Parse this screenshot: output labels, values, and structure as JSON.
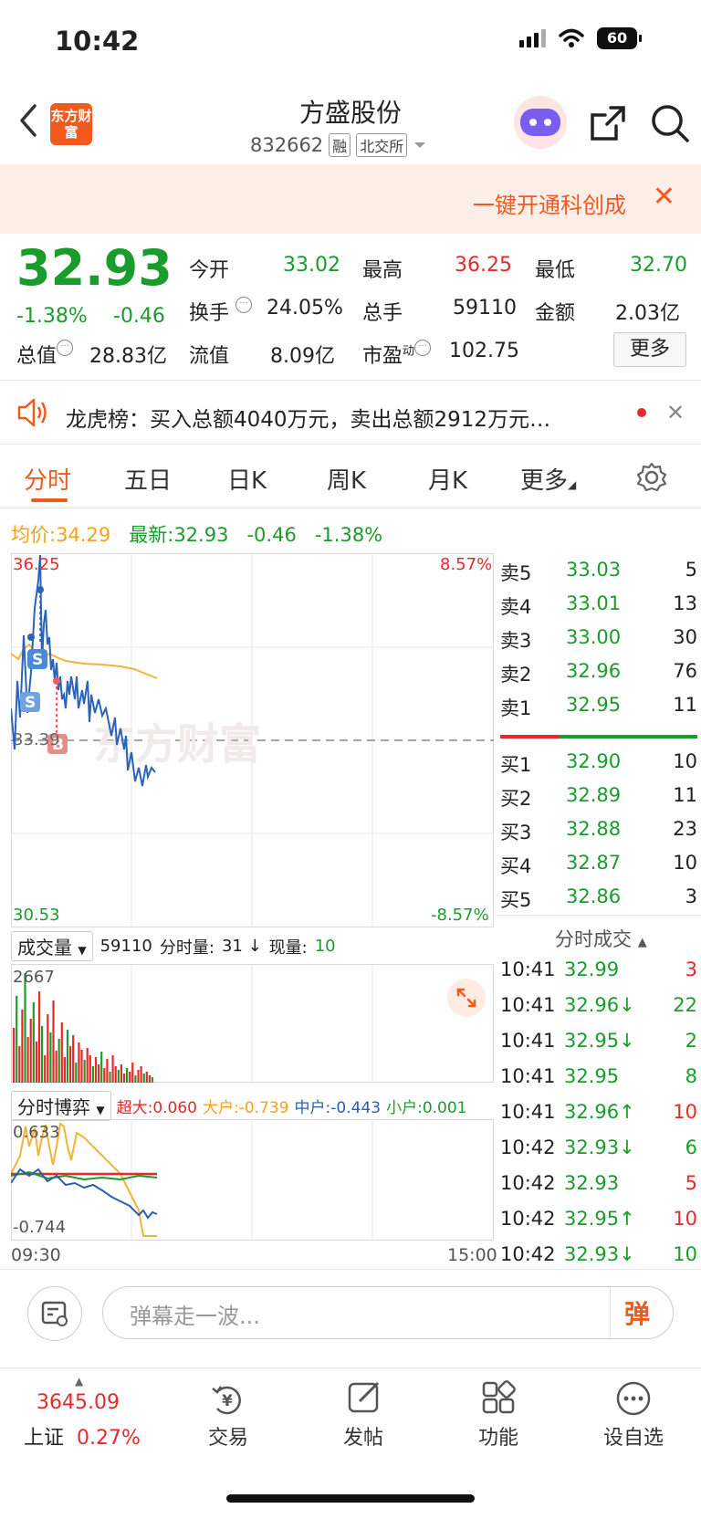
{
  "status_bar": {
    "time": "10:42",
    "battery": "60"
  },
  "header": {
    "logo_text": "东方财富",
    "title": "方盛股份",
    "code": "832662",
    "tag_margin": "融",
    "tag_exchange": "北交所"
  },
  "banner": {
    "text": "一键开通科创成"
  },
  "quote": {
    "price": "32.93",
    "change_pct": "-1.38%",
    "change": "-0.46",
    "fields": [
      {
        "label": "今开",
        "value": "33.02"
      },
      {
        "label": "最高",
        "value": "36.25"
      },
      {
        "label": "最低",
        "value": "32.70"
      },
      {
        "label": "换手",
        "value": "24.05%"
      },
      {
        "label": "总手",
        "value": "59110"
      },
      {
        "label": "金额",
        "value": "2.03亿"
      },
      {
        "label": "总值",
        "value": "28.83亿"
      },
      {
        "label": "流值",
        "value": "8.09亿"
      },
      {
        "label": "市盈",
        "value": "102.75"
      }
    ],
    "pe_sup": "动",
    "more": "更多"
  },
  "dragon_tiger": {
    "text": "龙虎榜：买入总额4040万元，卖出总额2912万元…"
  },
  "tabs": [
    "分时",
    "五日",
    "日K",
    "周K",
    "月K",
    "更多"
  ],
  "intraday": {
    "avg_label": "均价:",
    "avg_value": "34.29",
    "latest_label": "最新:",
    "latest_value": "32.93",
    "latest_change": "-0.46",
    "latest_pct": "-1.38%",
    "high_price": "36.25",
    "high_pct": "8.57%",
    "low_price": "30.53",
    "low_pct": "-8.57%",
    "prev_close": "33.39",
    "watermark": "东方财富",
    "marker_s": "S",
    "marker_b": "B",
    "time_start": "09:30",
    "time_end": "15:00"
  },
  "order_book": {
    "asks": [
      {
        "label": "卖5",
        "price": "33.03",
        "vol": "5"
      },
      {
        "label": "卖4",
        "price": "33.01",
        "vol": "13"
      },
      {
        "label": "卖3",
        "price": "33.00",
        "vol": "30"
      },
      {
        "label": "卖2",
        "price": "32.96",
        "vol": "76"
      },
      {
        "label": "卖1",
        "price": "32.95",
        "vol": "11"
      }
    ],
    "bids": [
      {
        "label": "买1",
        "price": "32.90",
        "vol": "10"
      },
      {
        "label": "买2",
        "price": "32.89",
        "vol": "11"
      },
      {
        "label": "买3",
        "price": "32.88",
        "vol": "23"
      },
      {
        "label": "买4",
        "price": "32.87",
        "vol": "10"
      },
      {
        "label": "买5",
        "price": "32.86",
        "vol": "3"
      }
    ]
  },
  "trades_title": "分时成交",
  "trades": [
    {
      "time": "10:41",
      "price": "32.99",
      "vol": "3",
      "dir": ""
    },
    {
      "time": "10:41",
      "price": "32.96↓",
      "vol": "22",
      "dir": "down"
    },
    {
      "time": "10:41",
      "price": "32.95↓",
      "vol": "2",
      "dir": "down"
    },
    {
      "time": "10:41",
      "price": "32.95",
      "vol": "8",
      "dir": ""
    },
    {
      "time": "10:41",
      "price": "32.96↑",
      "vol": "10",
      "dir": "up"
    },
    {
      "time": "10:42",
      "price": "32.93↓",
      "vol": "6",
      "dir": "down"
    },
    {
      "time": "10:42",
      "price": "32.93",
      "vol": "5",
      "dir": ""
    },
    {
      "time": "10:42",
      "price": "32.95↑",
      "vol": "10",
      "dir": "up"
    },
    {
      "time": "10:42",
      "price": "32.93↓",
      "vol": "10",
      "dir": "down"
    }
  ],
  "volume": {
    "selector": "成交量",
    "total": "59110",
    "minute_label": "分时量:",
    "minute_value": "31 ↓",
    "current_label": "现量:",
    "current_value": "10",
    "max": "2667"
  },
  "game": {
    "selector": "分时博弈",
    "super_label": "超大:",
    "super_value": "0.060",
    "large_label": "大户:",
    "large_value": "-0.739",
    "mid_label": "中户:",
    "mid_value": "-0.443",
    "small_label": "小户:",
    "small_value": "0.001",
    "top": "0.633",
    "bottom": "-0.744"
  },
  "danmu": {
    "placeholder": "弹幕走一波...",
    "button": "弹"
  },
  "tabbar": {
    "index_value": "3645.09",
    "index_name": "上证",
    "index_pct": "0.27%",
    "items": [
      "交易",
      "发帖",
      "功能",
      "设自选"
    ]
  }
}
